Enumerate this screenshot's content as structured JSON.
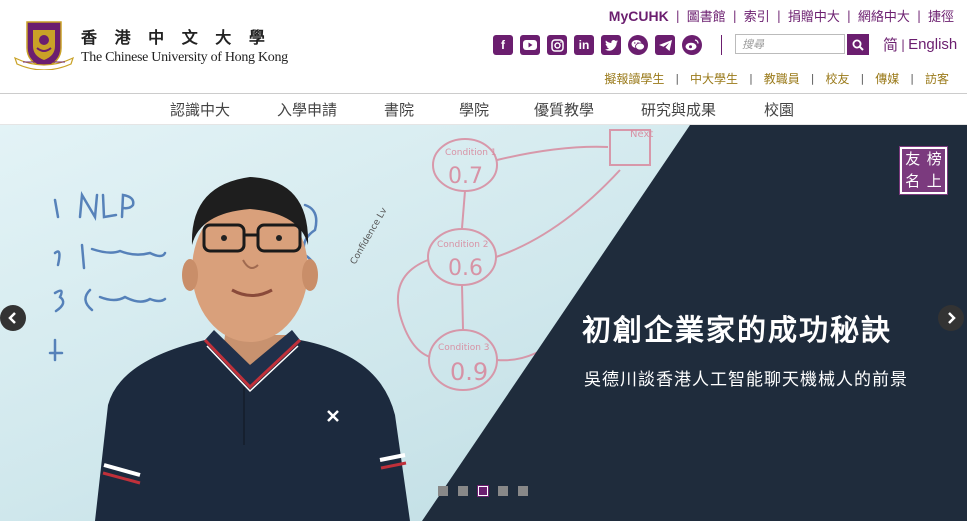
{
  "branding": {
    "name_zh": "香 港 中 文 大 學",
    "name_en": "The Chinese University of Hong Kong"
  },
  "top_links": [
    "MyCUHK",
    "圖書館",
    "索引",
    "捐贈中大",
    "網絡中大",
    "捷徑"
  ],
  "social_icons": [
    "facebook-icon",
    "youtube-icon",
    "instagram-icon",
    "linkedin-icon",
    "twitter-icon",
    "wechat-icon",
    "telegram-icon",
    "weibo-icon"
  ],
  "search": {
    "placeholder": "搜尋"
  },
  "language": {
    "simplified": "简",
    "english": "English"
  },
  "audience_links": [
    "擬報讀學生",
    "中大學生",
    "教職員",
    "校友",
    "傳媒",
    "訪客"
  ],
  "main_nav": [
    "認識中大",
    "入學申請",
    "書院",
    "學院",
    "優質教學",
    "研究與成果",
    "校園"
  ],
  "banner": {
    "headline": "初創企業家的成功秘訣",
    "subheadline": "吳德川談香港人工智能聊天機械人的前景",
    "badge_chars": [
      "友",
      "榜",
      "名",
      "上"
    ],
    "whiteboard_text": [
      "1. NLP",
      "2. Integration",
      "3. Customer",
      "4.",
      "Condition 1",
      "0.7",
      "Condition 2",
      "0.6",
      "Condition 3",
      "0.9",
      "Next"
    ],
    "slide_count": 5,
    "active_slide": 3
  },
  "colors": {
    "brand_purple": "#6b1e6f",
    "gold_links": "#9a7a1a",
    "banner_dark": "#1f2c3c"
  }
}
